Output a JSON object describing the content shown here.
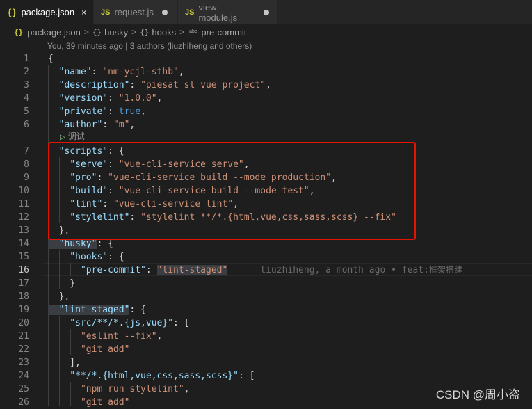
{
  "tabs": [
    {
      "icon": "{}",
      "label": "package.json",
      "active": true,
      "close": "×"
    },
    {
      "icon": "JS",
      "label": "request.js",
      "active": false
    },
    {
      "icon": "JS",
      "label": "view-module.js",
      "active": false
    }
  ],
  "breadcrumb": {
    "items": [
      "package.json",
      "husky",
      "hooks",
      "pre-commit"
    ],
    "sep": ">",
    "icon_json": "{}",
    "icon_obj": "{}",
    "icon_abc": "abc"
  },
  "codelens": {
    "top": "You, 39 minutes ago | 3 authors (liuzhiheng and others)",
    "debug_icon": "▷",
    "debug": "调试"
  },
  "lines": [
    {
      "n": "1",
      "tokens": [
        [
          "p",
          "{"
        ]
      ]
    },
    {
      "n": "2",
      "tokens": [
        [
          "k",
          "  \"name\""
        ],
        [
          "p",
          ": "
        ],
        [
          "s",
          "\"nm-ycjl-sthb\""
        ],
        [
          "p",
          ","
        ]
      ]
    },
    {
      "n": "3",
      "tokens": [
        [
          "k",
          "  \"description\""
        ],
        [
          "p",
          ": "
        ],
        [
          "s",
          "\"piesat sl vue project\""
        ],
        [
          "p",
          ","
        ]
      ]
    },
    {
      "n": "4",
      "tokens": [
        [
          "k",
          "  \"version\""
        ],
        [
          "p",
          ": "
        ],
        [
          "s",
          "\"1.0.0\""
        ],
        [
          "p",
          ","
        ]
      ]
    },
    {
      "n": "5",
      "tokens": [
        [
          "k",
          "  \"private\""
        ],
        [
          "p",
          ": "
        ],
        [
          "b",
          "true"
        ],
        [
          "p",
          ","
        ]
      ]
    },
    {
      "n": "6",
      "tokens": [
        [
          "k",
          "  \"author\""
        ],
        [
          "p",
          ": "
        ],
        [
          "s",
          "\"m\""
        ],
        [
          "p",
          ","
        ]
      ]
    },
    {
      "n": "7",
      "tokens": [
        [
          "k",
          "  \"scripts\""
        ],
        [
          "p",
          ": {"
        ]
      ]
    },
    {
      "n": "8",
      "tokens": [
        [
          "k",
          "    \"serve\""
        ],
        [
          "p",
          ": "
        ],
        [
          "s",
          "\"vue-cli-service serve\""
        ],
        [
          "p",
          ","
        ]
      ]
    },
    {
      "n": "9",
      "tokens": [
        [
          "k",
          "    \"pro\""
        ],
        [
          "p",
          ": "
        ],
        [
          "s",
          "\"vue-cli-service build --mode production\""
        ],
        [
          "p",
          ","
        ]
      ]
    },
    {
      "n": "10",
      "tokens": [
        [
          "k",
          "    \"build\""
        ],
        [
          "p",
          ": "
        ],
        [
          "s",
          "\"vue-cli-service build --mode test\""
        ],
        [
          "p",
          ","
        ]
      ]
    },
    {
      "n": "11",
      "tokens": [
        [
          "k",
          "    \"lint\""
        ],
        [
          "p",
          ": "
        ],
        [
          "s",
          "\"vue-cli-service lint\""
        ],
        [
          "p",
          ","
        ]
      ]
    },
    {
      "n": "12",
      "tokens": [
        [
          "k",
          "    \"stylelint\""
        ],
        [
          "p",
          ": "
        ],
        [
          "s",
          "\"stylelint **/*.{html,vue,css,sass,scss} --fix\""
        ]
      ]
    },
    {
      "n": "13",
      "tokens": [
        [
          "p",
          "  },"
        ]
      ]
    },
    {
      "n": "14",
      "tokens": [
        [
          "k",
          "  \"husky\""
        ],
        [
          "p",
          ": {"
        ]
      ]
    },
    {
      "n": "15",
      "tokens": [
        [
          "k",
          "    \"hooks\""
        ],
        [
          "p",
          ": {"
        ]
      ]
    },
    {
      "n": "16",
      "tokens": [
        [
          "k",
          "      \"pre-commit\""
        ],
        [
          "p",
          ": "
        ],
        [
          "s",
          "\"lint-staged\""
        ]
      ],
      "blame": "liuzhiheng, a month ago • feat:",
      "blame_cn": "框架搭建",
      "current": true
    },
    {
      "n": "17",
      "tokens": [
        [
          "p",
          "    }"
        ]
      ]
    },
    {
      "n": "18",
      "tokens": [
        [
          "p",
          "  },"
        ]
      ]
    },
    {
      "n": "19",
      "tokens": [
        [
          "k",
          "  \"lint-staged\""
        ],
        [
          "p",
          ": {"
        ]
      ]
    },
    {
      "n": "20",
      "tokens": [
        [
          "k",
          "    \"src/**/*.{js,vue}\""
        ],
        [
          "p",
          ": ["
        ]
      ]
    },
    {
      "n": "21",
      "tokens": [
        [
          "s",
          "      \"eslint --fix\""
        ],
        [
          "p",
          ","
        ]
      ]
    },
    {
      "n": "22",
      "tokens": [
        [
          "s",
          "      \"git add\""
        ]
      ]
    },
    {
      "n": "23",
      "tokens": [
        [
          "p",
          "    ],"
        ]
      ]
    },
    {
      "n": "24",
      "tokens": [
        [
          "k",
          "    \"**/*.{html,vue,css,sass,scss}\""
        ],
        [
          "p",
          ": ["
        ]
      ]
    },
    {
      "n": "25",
      "tokens": [
        [
          "s",
          "      \"npm run stylelint\""
        ],
        [
          "p",
          ","
        ]
      ]
    },
    {
      "n": "26",
      "tokens": [
        [
          "s",
          "      \"git add\""
        ]
      ]
    }
  ],
  "watermark": "CSDN @周小盗"
}
